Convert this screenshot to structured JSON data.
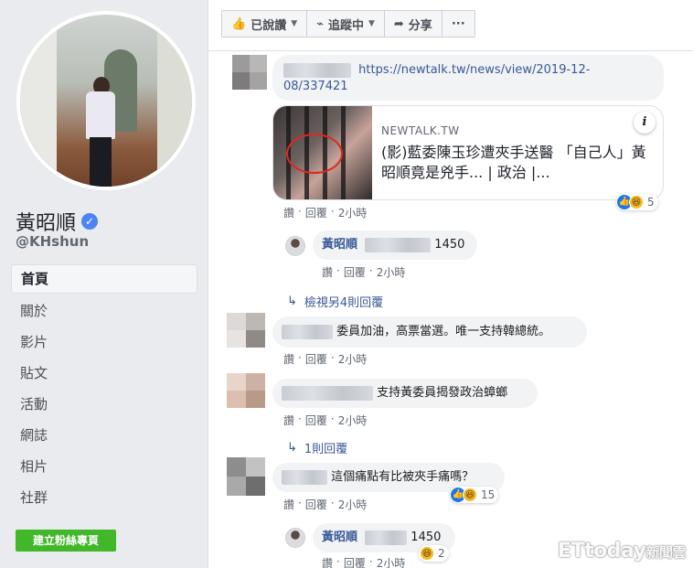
{
  "sidebar": {
    "page_name": "黃昭順",
    "username": "@KHshun",
    "nav": [
      "首頁",
      "關於",
      "影片",
      "貼文",
      "活動",
      "網誌",
      "相片",
      "社群"
    ],
    "create_button": "建立粉絲專頁"
  },
  "action_bar": {
    "liked": "已說讚",
    "following": "追蹤中",
    "share": "分享",
    "more": "···"
  },
  "comment_actions": {
    "like": "讚",
    "reply": "回覆"
  },
  "comments": [
    {
      "url_line1": "https://newtalk.tw/news/view/2019-12-",
      "url_line2": "08/337421",
      "card": {
        "domain": "NEWTALK.TW",
        "title": "(影)藍委陳玉珍遭夾手送醫 「自己人」黃昭順竟是兇手... | 政治 |..."
      },
      "reactions": "5",
      "time": "2小時"
    },
    {
      "author": "黃昭順",
      "text": "1450",
      "time": "2小時"
    },
    {
      "view_more": "檢視另4則回覆"
    },
    {
      "text": "委員加油，高票當選。唯一支持韓總統。",
      "time": "2小時"
    },
    {
      "text": "支持黃委員揭發政治蟑螂",
      "time": "2小時"
    },
    {
      "replies": "1則回覆"
    },
    {
      "text": "這個痛點有比被夾手痛嗎？",
      "reactions": "15",
      "time": "2小時"
    },
    {
      "author": "黃昭順",
      "text": "1450",
      "reactions": "2",
      "time": "2小時"
    }
  ],
  "watermark": {
    "main": "ETtoday",
    "sub": "新聞雲"
  },
  "colors": {
    "link": "#385898",
    "green": "#42b72a",
    "verified": "#4d84f5"
  }
}
